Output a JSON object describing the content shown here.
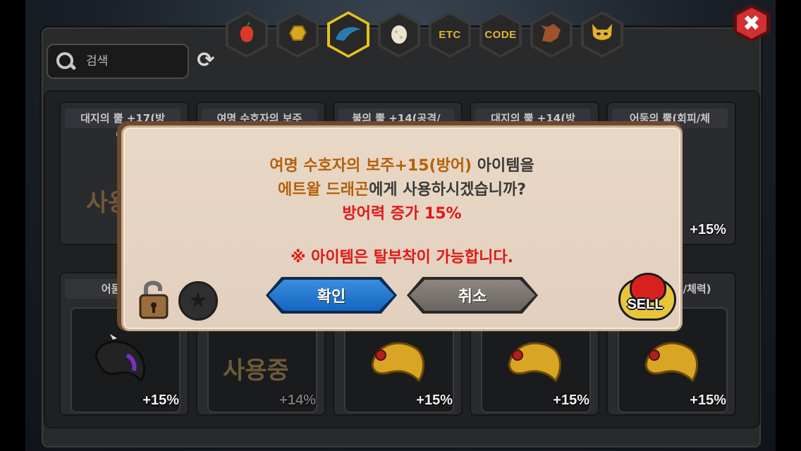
{
  "tabs": [
    {
      "name": "tab-fruit",
      "icon": "fruit-icon",
      "label": ""
    },
    {
      "name": "tab-gold",
      "icon": "gold-ore-icon",
      "label": ""
    },
    {
      "name": "tab-horn",
      "icon": "horn-icon",
      "label": ""
    },
    {
      "name": "tab-egg",
      "icon": "egg-icon",
      "label": ""
    },
    {
      "name": "tab-etc",
      "icon": "",
      "label": "ETC"
    },
    {
      "name": "tab-code",
      "icon": "",
      "label": "CODE"
    },
    {
      "name": "tab-dragon",
      "icon": "dragon-head-icon",
      "label": ""
    },
    {
      "name": "tab-mask",
      "icon": "devil-mask-icon",
      "label": ""
    }
  ],
  "search": {
    "placeholder": "검색"
  },
  "cards_top": [
    {
      "title": "대지의 뿔 +17(방"
    },
    {
      "title": "여명 수호자의 보주"
    },
    {
      "title": "불의 뿔 +14(공격/"
    },
    {
      "title": "대지의 뿔 +14(방"
    },
    {
      "title": "어둠의 뿔(회피/체"
    }
  ],
  "card_top_partial": {
    "title2": "어/",
    "inuse": "사용",
    "pct": "+15%"
  },
  "cards_bottom": [
    {
      "title": "어둠의 뿔",
      "pct": "+15%"
    },
    {
      "title": "",
      "inuse": "사용중",
      "pct": "+14%"
    },
    {
      "title": "",
      "pct": "+15%"
    },
    {
      "title": "",
      "pct": "+15%"
    },
    {
      "title": "l/체력)",
      "pct": "+15%"
    }
  ],
  "dialog": {
    "line1_item": "여명 수호자의 보주+15(방어)",
    "line1_rest": " 아이템을",
    "line2_target": "에트왈 드래곤",
    "line2_rest": "에게 사용하시겠습니까?",
    "line3": "방어력 증가 15%",
    "line4": "※ 아이템은 탈부착이 가능합니다.",
    "confirm_label": "확인",
    "cancel_label": "취소",
    "sell_label": "SELL"
  },
  "colors": {
    "accent": "#e6c21a",
    "confirm": "#1466bf",
    "warning": "#e01818",
    "item_name": "#b4600a"
  }
}
